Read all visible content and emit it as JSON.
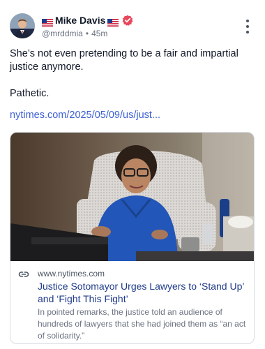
{
  "post": {
    "author": {
      "flag_left": "🇺🇸",
      "name": "Mike Davis",
      "flag_right": "🇺🇸",
      "handle": "@mrddmia",
      "separator": "•",
      "time": "45m",
      "verified_color": "#e8475b",
      "avatar_icon": "profile-photo"
    },
    "more_icon": "vertical-ellipsis",
    "body": [
      "She’s not even pretending to be a fair and impartial justice anymore.",
      "Pathetic."
    ],
    "link_text": "nytimes.com/2025/05/09/us/just...",
    "link_color": "#3b5fd4",
    "card": {
      "icon": "link-icon",
      "domain": "www.nytimes.com",
      "title": "Justice Sotomayor Urges Lawyers to ‘Stand Up’ and ‘Fight This Fight’",
      "description": "In pointed remarks, the justice told an audience of hundreds of lawyers that she had joined them as “an act of solidarity.”",
      "title_color": "#1e3a8a"
    }
  }
}
